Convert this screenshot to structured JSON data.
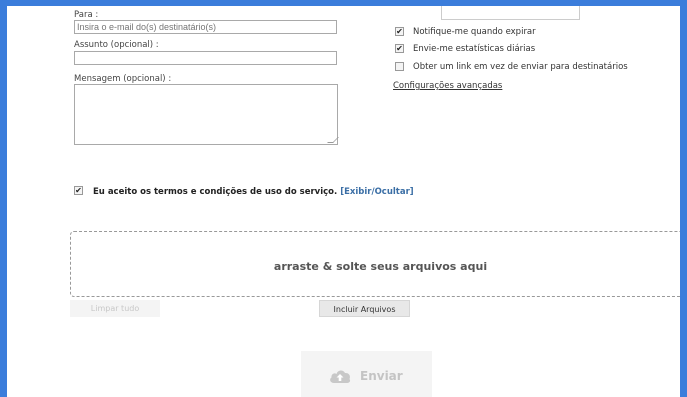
{
  "form": {
    "to_label": "Para :",
    "to_placeholder": "Insira o e-mail do(s) destinatário(s)",
    "subject_label": "Assunto (opcional) :",
    "subject_value": "",
    "message_label": "Mensagem (opcional) :",
    "message_value": ""
  },
  "options": {
    "items": [
      {
        "label": "Notifique-me quando expirar",
        "checked": true
      },
      {
        "label": "Envie-me estatísticas diárias",
        "checked": true
      },
      {
        "label": "Obter um link em vez de enviar para destinatários",
        "checked": false
      }
    ],
    "advanced_link": "Configurações avançadas"
  },
  "terms": {
    "checked": true,
    "text": "Eu aceito os termos e condições de uso do serviço.",
    "toggle": "[Exibir/Ocultar]"
  },
  "upload": {
    "dropzone_text": "arraste & solte seus arquivos aqui",
    "clear_label": "Limpar tudo",
    "add_label": "Incluir Arquivos",
    "send_label": "Enviar"
  },
  "colors": {
    "page_border": "#3b7ddb",
    "link": "#3a6ea5"
  }
}
